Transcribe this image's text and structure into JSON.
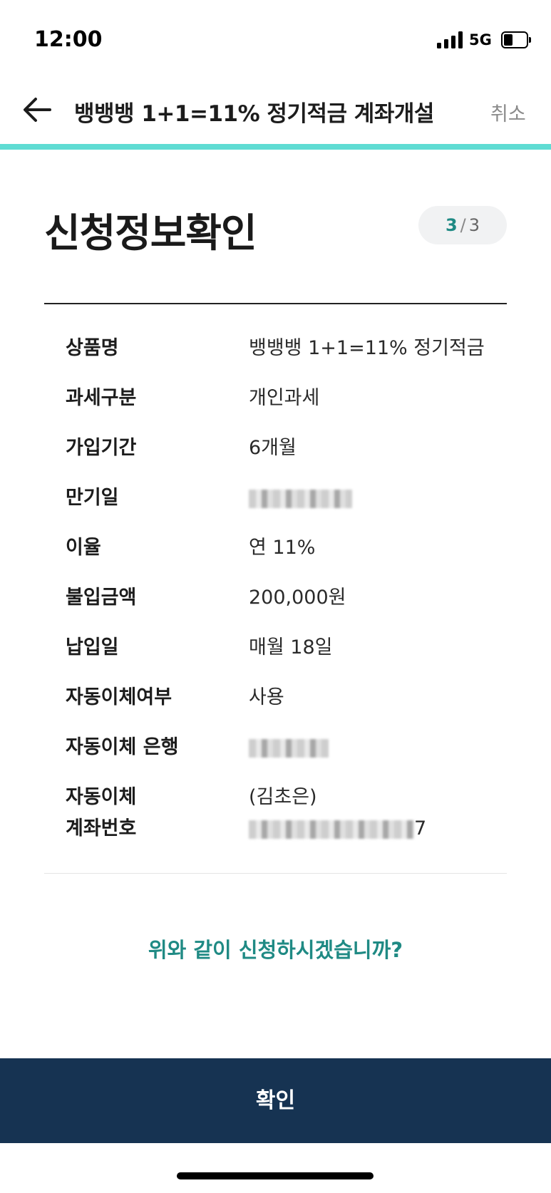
{
  "status_bar": {
    "time": "12:00",
    "network": "5G",
    "signal_icon": "signal-bars-icon",
    "battery_icon": "battery-icon"
  },
  "header": {
    "back_icon": "arrow-left-icon",
    "title": "뱅뱅뱅 1+1=11% 정기적금 계좌개설",
    "cancel_label": "취소",
    "progress": 1.0,
    "progress_color": "#5fdcd3"
  },
  "page": {
    "title": "신청정보확인",
    "step_current": "3",
    "step_separator": "/",
    "step_total": "3"
  },
  "details": [
    {
      "label_lines": [
        "상품명"
      ],
      "value_lines": [
        "뱅뱅뱅 1+1=11% 정기적금"
      ]
    },
    {
      "label_lines": [
        "과세구분"
      ],
      "value_lines": [
        "개인과세"
      ]
    },
    {
      "label_lines": [
        "가입기간"
      ],
      "value_lines": [
        "6개월"
      ]
    },
    {
      "label_lines": [
        "만기일"
      ],
      "value_lines": [
        ""
      ]
    },
    {
      "label_lines": [
        "이율"
      ],
      "value_lines": [
        "연 11%"
      ]
    },
    {
      "label_lines": [
        "불입금액"
      ],
      "value_lines": [
        "200,000원"
      ]
    },
    {
      "label_lines": [
        "납입일"
      ],
      "value_lines": [
        "매월 18일"
      ]
    },
    {
      "label_lines": [
        "자동이체여부"
      ],
      "value_lines": [
        "사용"
      ]
    },
    {
      "label_lines": [
        "자동이체 은행"
      ],
      "value_lines": [
        ""
      ]
    },
    {
      "label_lines": [
        "자동이체",
        "계좌번호"
      ],
      "value_lines": [
        "(김초은)",
        "7"
      ]
    }
  ],
  "confirm_question": "위와 같이 신청하시겠습니까?",
  "confirm_button": "확인",
  "colors": {
    "accent": "#1f8a84",
    "button_bg": "#163352"
  }
}
